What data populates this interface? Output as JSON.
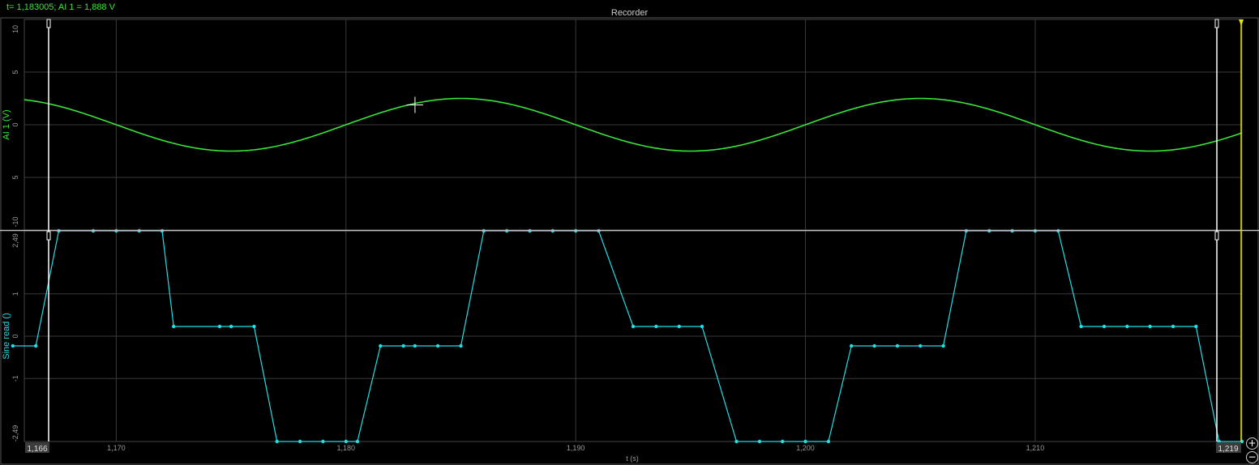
{
  "header": {
    "cursor_readout": "t= 1,183005; AI 1 = 1,888 V",
    "title": "Recorder"
  },
  "icons": {
    "zoom_in": "plus-circle-icon",
    "zoom_out": "minus-circle-icon",
    "crosshair": "crosshair-cursor-icon"
  },
  "colors": {
    "background": "#000000",
    "grid": "#3a3a3a",
    "ai1_trace": "#39e639",
    "sine_read_trace": "#1ee0e6",
    "cursor_marker": "#ffffff",
    "end_marker": "#e6e600"
  },
  "chart_data": [
    {
      "type": "line",
      "title": "",
      "xlabel": "t (s)",
      "ylabel": "AI 1 (V)",
      "xlim": [
        1.166,
        1.219
      ],
      "ylim": [
        -10,
        10
      ],
      "yticks": [
        10,
        5,
        0,
        -5,
        -10
      ],
      "ytick_labels": [
        "10",
        "5",
        "0",
        "5",
        "-10"
      ],
      "grid": true,
      "series": [
        {
          "name": "AI 1",
          "function": "sine",
          "amplitude": 2.5,
          "frequency_hz": 50,
          "samples": {
            "x": [
              1.166,
              1.17,
              1.175,
              1.18,
              1.183005,
              1.185,
              1.19,
              1.195,
              1.2,
              1.205,
              1.21,
              1.215,
              1.219
            ],
            "y": [
              2.2,
              0.0,
              -2.4,
              0.0,
              1.888,
              2.5,
              0.0,
              -2.5,
              0.0,
              2.5,
              0.0,
              -2.5,
              -1.0
            ]
          }
        }
      ],
      "cursor": {
        "x": 1.183005,
        "y": 1.888
      }
    },
    {
      "type": "line",
      "title": "",
      "xlabel": "t (s)",
      "ylabel": "Sine read ()",
      "xlim": [
        1.166,
        1.219
      ],
      "ylim": [
        -2.49,
        2.49
      ],
      "yticks": [
        2.49,
        1,
        0,
        -1,
        -2.49
      ],
      "ytick_labels": [
        "2,49",
        "1",
        "0",
        "-1",
        "-2,49"
      ],
      "grid": true,
      "series": [
        {
          "name": "Sine read",
          "x": [
            1.1655,
            1.1665,
            1.1675,
            1.169,
            1.17,
            1.171,
            1.172,
            1.1725,
            1.1745,
            1.175,
            1.176,
            1.177,
            1.178,
            1.179,
            1.18,
            1.1805,
            1.1815,
            1.1825,
            1.183,
            1.184,
            1.185,
            1.186,
            1.187,
            1.188,
            1.189,
            1.19,
            1.191,
            1.1925,
            1.1935,
            1.1945,
            1.1955,
            1.197,
            1.198,
            1.199,
            1.2,
            1.201,
            1.202,
            1.203,
            1.204,
            1.205,
            1.206,
            1.207,
            1.208,
            1.209,
            1.21,
            1.211,
            1.212,
            1.213,
            1.214,
            1.215,
            1.216,
            1.217,
            1.218,
            1.219
          ],
          "y": [
            -0.23,
            -0.23,
            2.49,
            2.49,
            2.49,
            2.49,
            2.49,
            0.23,
            0.23,
            0.23,
            0.23,
            -2.49,
            -2.49,
            -2.49,
            -2.49,
            -2.49,
            -0.23,
            -0.23,
            -0.23,
            -0.23,
            -0.23,
            2.49,
            2.49,
            2.49,
            2.49,
            2.49,
            2.49,
            0.23,
            0.23,
            0.23,
            0.23,
            -2.49,
            -2.49,
            -2.49,
            -2.49,
            -2.49,
            -0.23,
            -0.23,
            -0.23,
            -0.23,
            -0.23,
            2.49,
            2.49,
            2.49,
            2.49,
            2.49,
            0.23,
            0.23,
            0.23,
            0.23,
            0.23,
            0.23,
            -2.49,
            -2.49
          ]
        }
      ]
    }
  ],
  "x_axis": {
    "label": "t (s)",
    "ticks": [
      1.17,
      1.18,
      1.19,
      1.2,
      1.21
    ],
    "tick_labels": [
      "1,170",
      "1,180",
      "1,190",
      "1,200",
      "1,210"
    ],
    "start_label": "1,166",
    "end_label": "1,219"
  }
}
